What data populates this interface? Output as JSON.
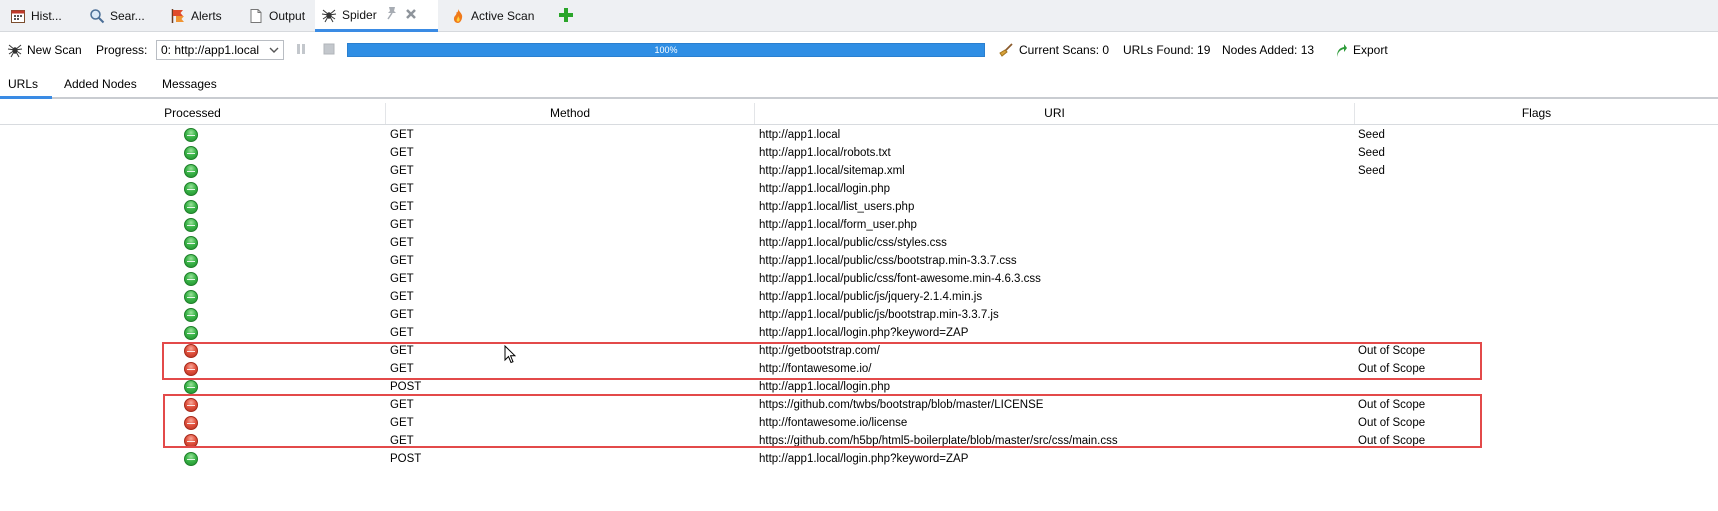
{
  "tabs": [
    {
      "label": "Hist...",
      "icon": "calendar-icon"
    },
    {
      "label": "Sear...",
      "icon": "magnifier-icon"
    },
    {
      "label": "Alerts",
      "icon": "flag-icon"
    },
    {
      "label": "Output",
      "icon": "document-icon"
    },
    {
      "label": "Spider",
      "icon": "spider-icon",
      "active": true
    },
    {
      "label": "Active Scan",
      "icon": "flame-icon"
    }
  ],
  "toolbar": {
    "new_scan_label": "New Scan",
    "progress_label": "Progress:",
    "progress_selected": "0: http://app1.local",
    "progress_value": "100%",
    "progress_fraction": 1.0,
    "current_scans": "Current Scans: 0",
    "urls_found": "URLs Found: 19",
    "nodes_added": "Nodes Added: 13",
    "export_label": "Export"
  },
  "subtabs": [
    {
      "label": "URLs",
      "active": true
    },
    {
      "label": "Added Nodes"
    },
    {
      "label": "Messages"
    }
  ],
  "table": {
    "headers": [
      "Processed",
      "Method",
      "URI",
      "Flags"
    ],
    "rows": [
      {
        "status": "ok",
        "method": "GET",
        "uri": "http://app1.local",
        "flags": "Seed"
      },
      {
        "status": "ok",
        "method": "GET",
        "uri": "http://app1.local/robots.txt",
        "flags": "Seed"
      },
      {
        "status": "ok",
        "method": "GET",
        "uri": "http://app1.local/sitemap.xml",
        "flags": "Seed"
      },
      {
        "status": "ok",
        "method": "GET",
        "uri": "http://app1.local/login.php",
        "flags": ""
      },
      {
        "status": "ok",
        "method": "GET",
        "uri": "http://app1.local/list_users.php",
        "flags": ""
      },
      {
        "status": "ok",
        "method": "GET",
        "uri": "http://app1.local/form_user.php",
        "flags": ""
      },
      {
        "status": "ok",
        "method": "GET",
        "uri": "http://app1.local/public/css/styles.css",
        "flags": ""
      },
      {
        "status": "ok",
        "method": "GET",
        "uri": "http://app1.local/public/css/bootstrap.min-3.3.7.css",
        "flags": ""
      },
      {
        "status": "ok",
        "method": "GET",
        "uri": "http://app1.local/public/css/font-awesome.min-4.6.3.css",
        "flags": ""
      },
      {
        "status": "ok",
        "method": "GET",
        "uri": "http://app1.local/public/js/jquery-2.1.4.min.js",
        "flags": ""
      },
      {
        "status": "ok",
        "method": "GET",
        "uri": "http://app1.local/public/js/bootstrap.min-3.3.7.js",
        "flags": ""
      },
      {
        "status": "ok",
        "method": "GET",
        "uri": "http://app1.local/login.php?keyword=ZAP",
        "flags": ""
      },
      {
        "status": "bad",
        "method": "GET",
        "uri": "http://getbootstrap.com/",
        "flags": "Out of Scope"
      },
      {
        "status": "bad",
        "method": "GET",
        "uri": "http://fontawesome.io/",
        "flags": "Out of Scope"
      },
      {
        "status": "ok",
        "method": "POST",
        "uri": "http://app1.local/login.php",
        "flags": ""
      },
      {
        "status": "bad",
        "method": "GET",
        "uri": "https://github.com/twbs/bootstrap/blob/master/LICENSE",
        "flags": "Out of Scope"
      },
      {
        "status": "bad",
        "method": "GET",
        "uri": "http://fontawesome.io/license",
        "flags": "Out of Scope"
      },
      {
        "status": "bad",
        "method": "GET",
        "uri": "https://github.com/h5bp/html5-boilerplate/blob/master/src/css/main.css",
        "flags": "Out of Scope"
      },
      {
        "status": "ok",
        "method": "POST",
        "uri": "http://app1.local/login.php?keyword=ZAP",
        "flags": ""
      }
    ]
  },
  "colors": {
    "accent": "#3a8be4",
    "progress": "#2f8ee4",
    "ok": "#3cb64a",
    "out_of_scope": "#e2533f",
    "highlight_box": "#e34a4a"
  }
}
